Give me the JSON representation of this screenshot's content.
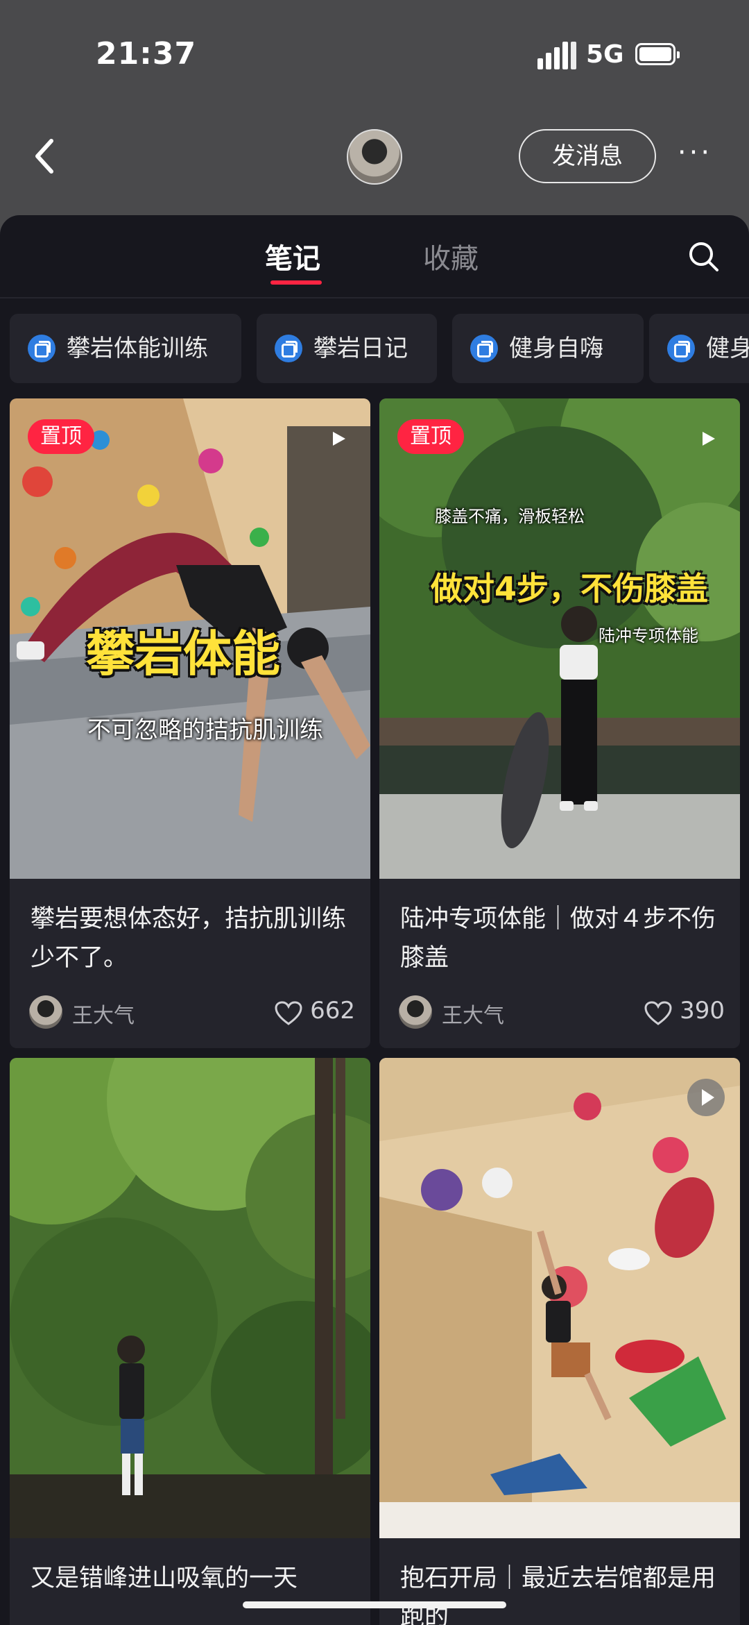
{
  "status_bar": {
    "time": "21:37",
    "network": "5G"
  },
  "header": {
    "message_button": "发消息",
    "more": "···"
  },
  "tabs": [
    {
      "label": "笔记",
      "active": true
    },
    {
      "label": "收藏",
      "active": false
    }
  ],
  "collections": [
    {
      "label": "攀岩体能训练"
    },
    {
      "label": "攀岩日记"
    },
    {
      "label": "健身自嗨"
    },
    {
      "label": "健身"
    }
  ],
  "notes": [
    {
      "pinned_label": "置顶",
      "video": true,
      "cover_text": {
        "big": "攀岩体能",
        "small": "不可忽略的拮抗肌训练"
      },
      "title": "攀岩要想体态好，拮抗肌训练少不了。",
      "author": "王大气",
      "likes": "662"
    },
    {
      "pinned_label": "置顶",
      "video": true,
      "cover_text": {
        "top": "膝盖不痛，滑板轻松",
        "big": "做对4步，不伤膝盖",
        "side": "陆冲专项体能"
      },
      "title": "陆冲专项体能｜做对４步不伤膝盖",
      "author": "王大气",
      "likes": "390"
    },
    {
      "video": false,
      "title": "又是错峰进山吸氧的一天"
    },
    {
      "video": true,
      "title": "抱石开局｜最近去岩馆都是用跑的"
    }
  ],
  "colors": {
    "accent": "#ff2442",
    "sheet_bg": "#17171e",
    "card_bg": "#24242c",
    "collection_icon": "#2f7de1"
  }
}
